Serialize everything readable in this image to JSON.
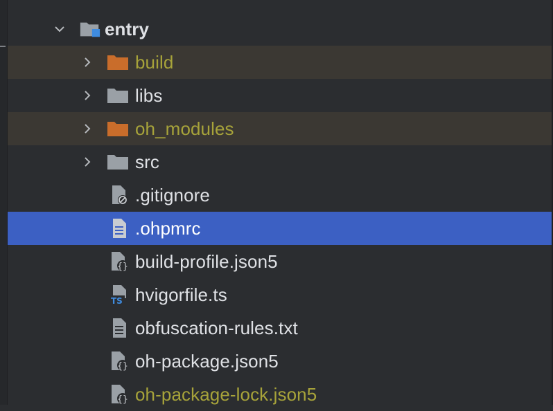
{
  "tree": {
    "root": {
      "label": "entry",
      "expanded": true,
      "icon": "module-folder-icon"
    },
    "items": [
      {
        "label": "build",
        "kind": "folder",
        "status": "ignored",
        "icon": "folder-excluded-icon"
      },
      {
        "label": "libs",
        "kind": "folder",
        "status": "normal",
        "icon": "folder-icon"
      },
      {
        "label": "oh_modules",
        "kind": "folder",
        "status": "ignored",
        "icon": "folder-excluded-icon"
      },
      {
        "label": "src",
        "kind": "folder",
        "status": "normal",
        "icon": "folder-icon"
      },
      {
        "label": ".gitignore",
        "kind": "file",
        "status": "normal",
        "icon": "gitignore-file-icon"
      },
      {
        "label": ".ohpmrc",
        "kind": "file",
        "status": "selected",
        "icon": "text-file-icon"
      },
      {
        "label": "build-profile.json5",
        "kind": "file",
        "status": "normal",
        "icon": "json-file-icon"
      },
      {
        "label": "hvigorfile.ts",
        "kind": "file",
        "status": "normal",
        "icon": "typescript-file-icon"
      },
      {
        "label": "obfuscation-rules.txt",
        "kind": "file",
        "status": "normal",
        "icon": "text-file-icon"
      },
      {
        "label": "oh-package.json5",
        "kind": "file",
        "status": "normal",
        "icon": "json-file-icon"
      },
      {
        "label": "oh-package-lock.json5",
        "kind": "file",
        "status": "ignored",
        "icon": "json-file-icon"
      }
    ]
  },
  "colors": {
    "background": "#2b2d30",
    "selection": "#3c60c3",
    "ignored_row": "#3b3833",
    "ignored_text": "#a7a33a",
    "text": "#dfe1e5",
    "folder": "#9aa0a6",
    "excluded_folder": "#c96d2b",
    "module_accent": "#3f8ce0"
  }
}
